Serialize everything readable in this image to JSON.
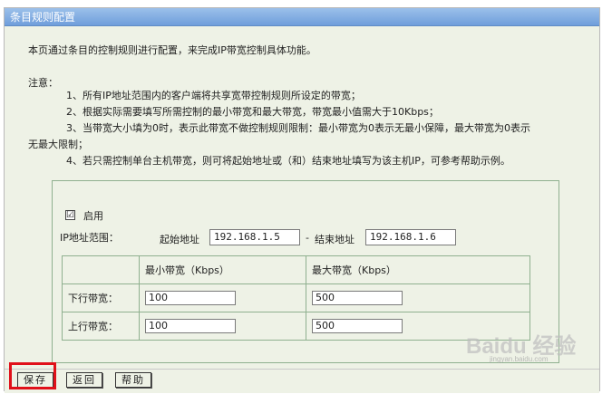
{
  "window_title": "条目规则配置",
  "intro": "本页通过条目的控制规则进行配置，来完成IP带宽控制具体功能。",
  "notes": {
    "heading": "注意：",
    "lines": [
      "1、所有IP地址范围内的客户端将共享宽带控制规则所设定的带宽；",
      "2、根据实际需要填写所需控制的最小带宽和最大带宽，带宽最小值需大于10Kbps；",
      "3、当带宽大小填为0时，表示此带宽不做控制规则限制：最小带宽为0表示无最小保障，最大带宽为0表示",
      "无最大限制；",
      "4、若只需控制单台主机带宽，则可将起始地址或（和）结束地址填写为该主机IP，可参考帮助示例。"
    ]
  },
  "form": {
    "enable_label": "启用",
    "enable_checked": "☑",
    "ip_range_label": "IP地址范围：",
    "start_label": "起始地址",
    "start_value": "192.168.1.5",
    "separator": "-",
    "end_label": "结束地址",
    "end_value": "192.168.1.6"
  },
  "bandwidth_table": {
    "headers": [
      "",
      "最小带宽（Kbps）",
      "最大带宽（Kbps）"
    ],
    "rows": [
      {
        "label": "下行带宽：",
        "min": "100",
        "max": "500"
      },
      {
        "label": "上行带宽：",
        "min": "100",
        "max": "500"
      }
    ]
  },
  "buttons": {
    "save": "保存",
    "back": "返回",
    "help": "帮助"
  },
  "watermark": {
    "text": "Baidu 经验",
    "sub": "jingyan.baidu.com"
  },
  "colors": {
    "title_bar": "#7fa8df",
    "panel_bg": "#eef2e6",
    "highlight": "#e0101a"
  }
}
